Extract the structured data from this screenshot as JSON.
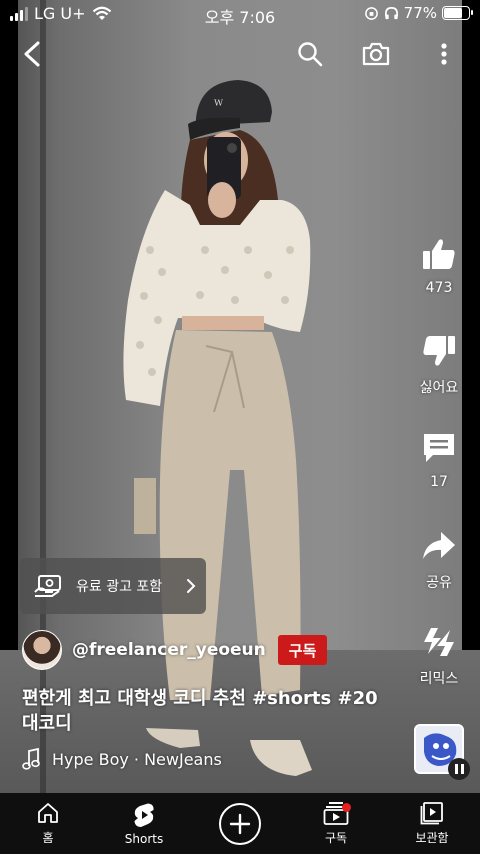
{
  "status_bar": {
    "carrier": "LG U+",
    "time": "오후 7:06",
    "battery_percent": "77%",
    "battery_level": 0.77
  },
  "top_nav": {
    "icons": [
      "back-arrow-icon",
      "search-icon",
      "camera-icon",
      "more-vert-icon"
    ]
  },
  "actions": {
    "like": {
      "icon": "thumb-up-icon",
      "label": "473"
    },
    "dislike": {
      "icon": "thumb-down-icon",
      "label": "싫어요"
    },
    "comments": {
      "icon": "comment-icon",
      "label": "17"
    },
    "share": {
      "icon": "share-icon",
      "label": "공유"
    },
    "remix": {
      "icon": "remix-icon",
      "label": "리믹스"
    }
  },
  "ad_pill": {
    "icon": "paid-promo-icon",
    "text": "유료 광고 포함"
  },
  "channel": {
    "handle": "@freelancer_yeoeun",
    "subscribe_label": "구독"
  },
  "video": {
    "title_plain": "편한게 최고 대학생 코디 추천 ",
    "title_tags": "#shorts #20",
    "title_line2": "대코디"
  },
  "music": {
    "icon": "music-note-icon",
    "track": "Hype Boy · NewJeans"
  },
  "tabbar": {
    "items": [
      {
        "icon": "home-icon",
        "label": "홈"
      },
      {
        "icon": "shorts-icon",
        "label": "Shorts"
      },
      {
        "icon": "create-plus-icon",
        "label": ""
      },
      {
        "icon": "subscriptions-icon",
        "label": "구독"
      },
      {
        "icon": "library-icon",
        "label": "보관함"
      }
    ]
  },
  "colors": {
    "subscribe_red": "#cc1a1a",
    "tabbar_bg": "#0f0f0f",
    "notification_dot": "#e52020"
  }
}
